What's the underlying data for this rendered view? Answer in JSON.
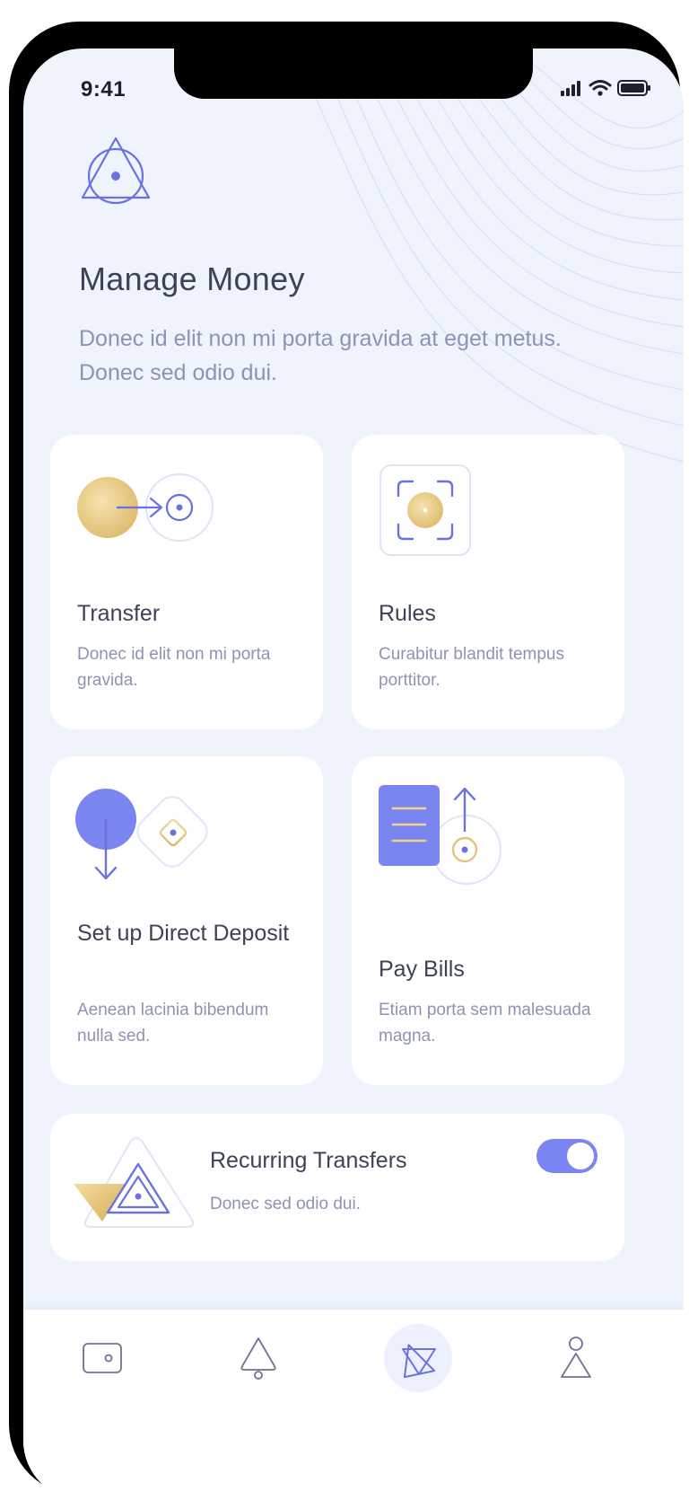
{
  "status_bar": {
    "time": "9:41"
  },
  "header": {
    "title": "Manage Money",
    "subtitle": "Donec id elit non mi porta gravida at eget metus. Donec sed odio dui."
  },
  "cards": [
    {
      "title": "Transfer",
      "description": "Donec id elit non mi porta gravida.",
      "icon": "transfer-icon"
    },
    {
      "title": "Rules",
      "description": "Curabitur blandit tempus porttitor.",
      "icon": "rules-icon"
    },
    {
      "title": "Set up Direct Deposit",
      "description": "Aenean lacinia bibendum nulla sed.",
      "icon": "direct-deposit-icon"
    },
    {
      "title": "Pay Bills",
      "description": "Etiam porta sem malesuada magna.",
      "icon": "pay-bills-icon"
    }
  ],
  "recurring": {
    "title": "Recurring Transfers",
    "description": "Donec sed odio dui.",
    "enabled": true,
    "icon": "recurring-transfers-icon"
  },
  "tab_bar": {
    "tabs": [
      {
        "icon": "wallet-icon",
        "active": false
      },
      {
        "icon": "bell-icon",
        "active": false
      },
      {
        "icon": "home-logo-icon",
        "active": true
      },
      {
        "icon": "profile-icon",
        "active": false
      }
    ]
  },
  "colors": {
    "background": "#eef3fc",
    "accent": "#7b85f2",
    "gold": "#e9cc87",
    "title_text": "#3e4257",
    "muted_text": "#8e93b4"
  }
}
